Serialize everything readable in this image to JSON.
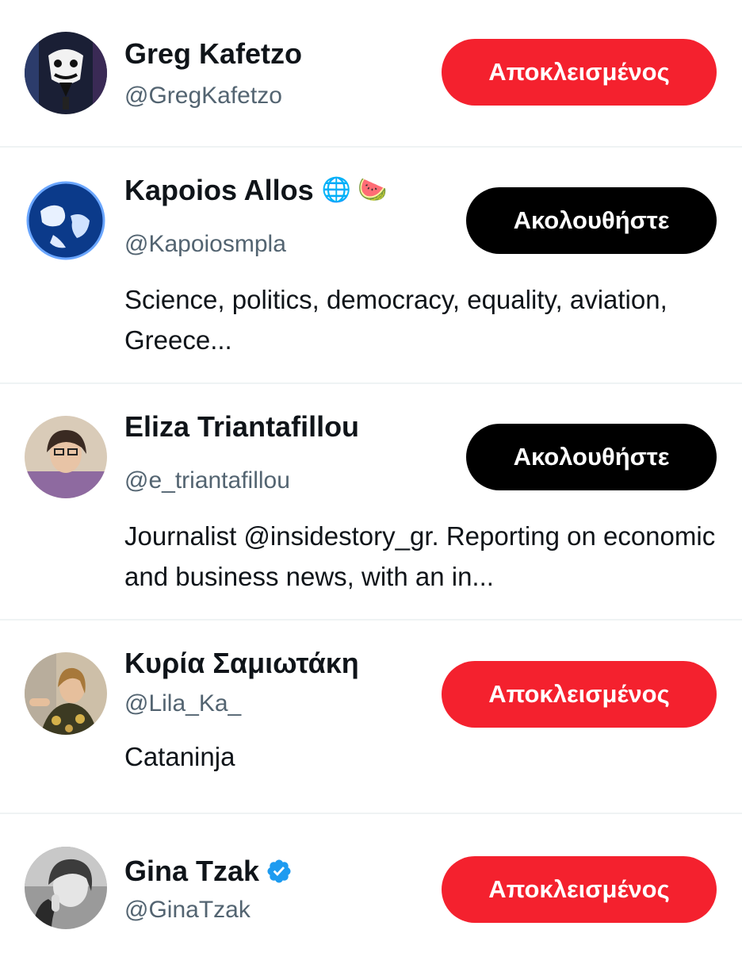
{
  "colors": {
    "blocked_button": "#f4212e",
    "follow_button": "#000000",
    "handle_text": "#536471",
    "verified": "#1d9bf0",
    "divider": "#eff3f4"
  },
  "users": [
    {
      "name": "Greg Kafetzo",
      "handle": "@GregKafetzo",
      "bio": "",
      "button": "Αποκλεισμένος",
      "button_state": "blocked",
      "avatar": "mask-avatar"
    },
    {
      "name": "Kapoios Allos",
      "emoji": "🌐 🍉",
      "handle": "@Kapoiosmpla",
      "bio": "Science, politics, democracy, equality, aviation, Greece...",
      "button": "Ακολουθήστε",
      "button_state": "follow",
      "avatar": "globe-avatar"
    },
    {
      "name": "Eliza Triantafillou",
      "handle": "@e_triantafillou",
      "bio": "Journalist @insidestory_gr. Reporting on economic and business news, with an in...",
      "button": "Ακολουθήστε",
      "button_state": "follow",
      "avatar": "photo-avatar"
    },
    {
      "name": "Κυρία Σαμιωτάκη",
      "handle": "@Lila_Ka_",
      "bio": "Cataninja",
      "button": "Αποκλεισμένος",
      "button_state": "blocked",
      "avatar": "photo-avatar"
    },
    {
      "name": "Gina Tzak",
      "verified": true,
      "verified_icon": "verified-badge-icon",
      "handle": "@GinaTzak",
      "bio": "",
      "button": "Αποκλεισμένος",
      "button_state": "blocked",
      "avatar": "bw-photo-avatar"
    }
  ]
}
